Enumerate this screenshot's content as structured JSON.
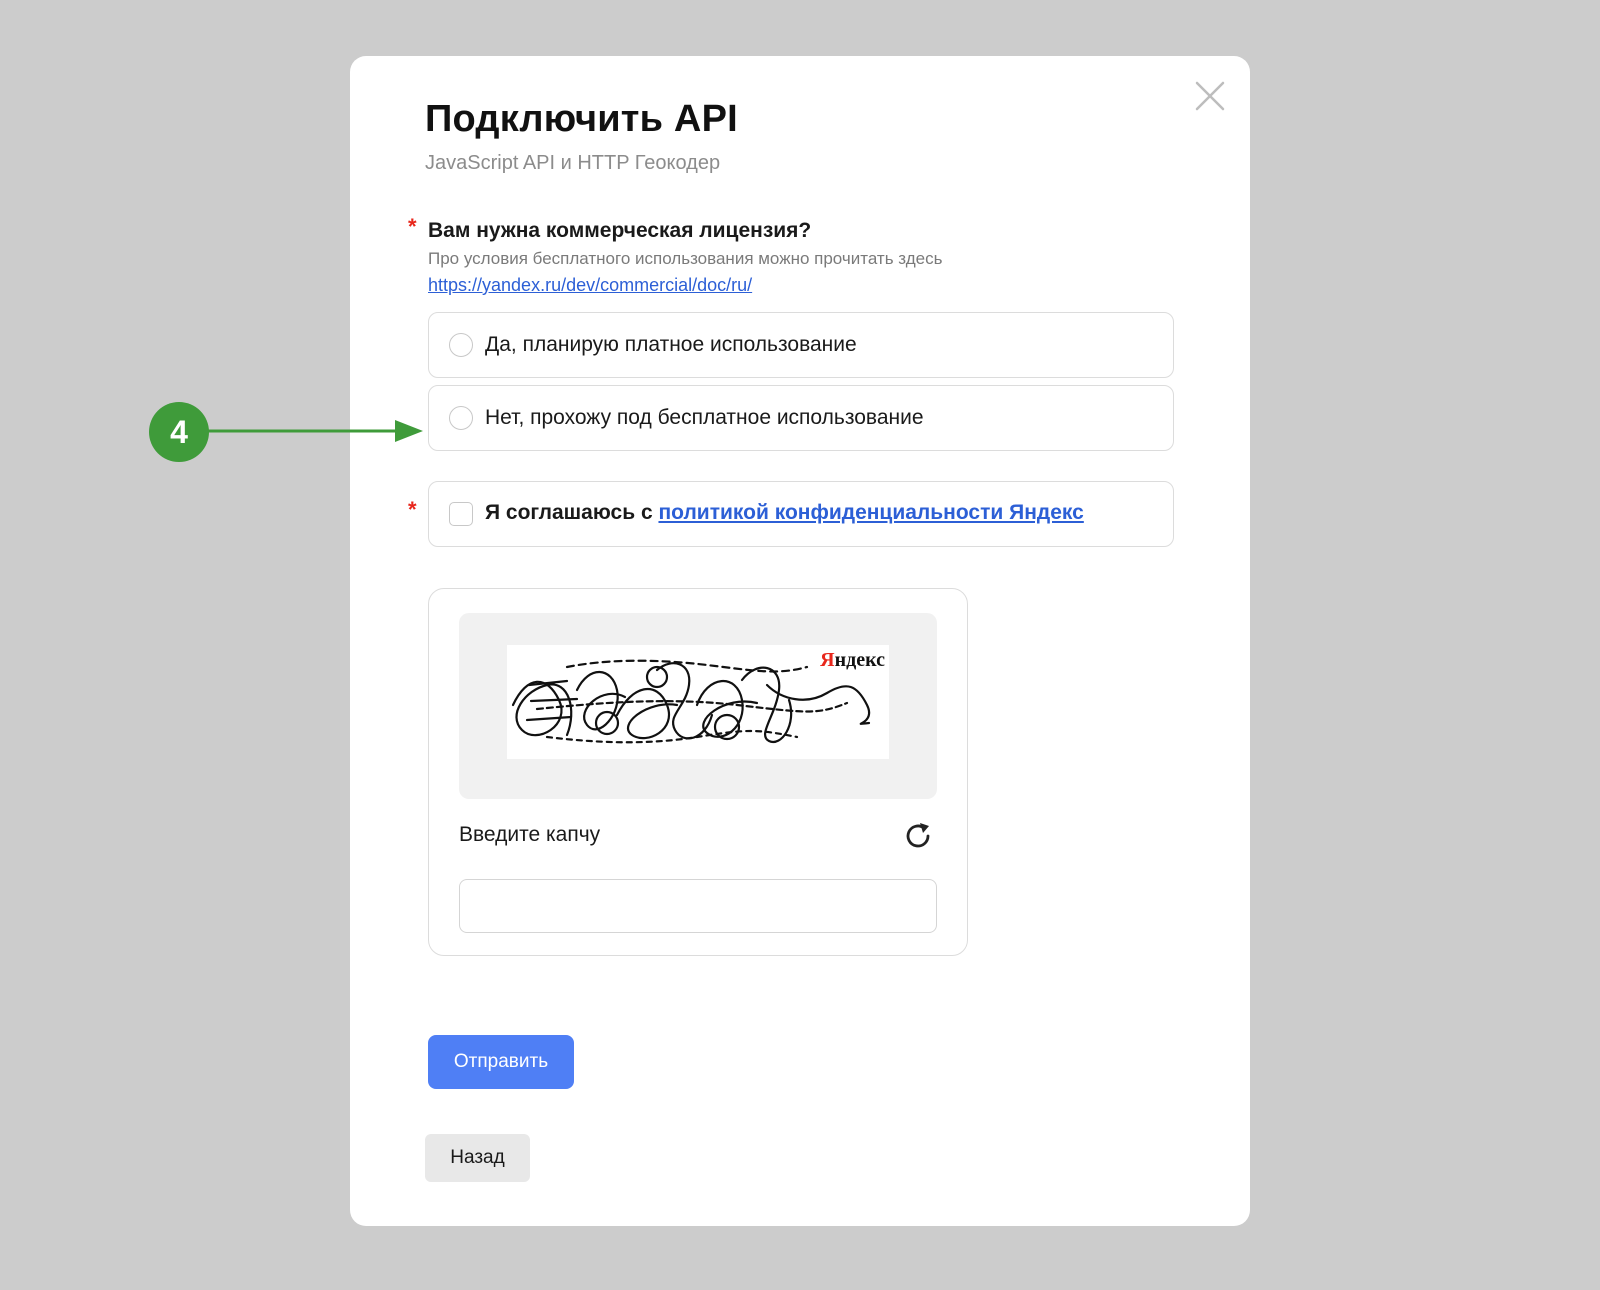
{
  "modal": {
    "title": "Подключить API",
    "subtitle": "JavaScript API и HTTP Геокодер",
    "close_icon": "close-icon"
  },
  "license_question": {
    "required_marker": "*",
    "label": "Вам нужна коммерческая лицензия?",
    "hint": "Про условия бесплатного использования можно прочитать здесь",
    "link": "https://yandex.ru/dev/commercial/doc/ru/",
    "options": [
      {
        "label": "Да, планирую платное использование",
        "selected": false
      },
      {
        "label": "Нет, прохожу под бесплатное использование",
        "selected": false
      }
    ]
  },
  "agreement": {
    "required_marker": "*",
    "prefix": "Я соглашаюсь с ",
    "link_text": "политикой конфиденциальности Яндекс",
    "checked": false
  },
  "captcha": {
    "logo_first": "Я",
    "logo_rest": "ндекс",
    "caption": "Введите капчу",
    "refresh_icon": "refresh-icon",
    "input_value": "",
    "input_placeholder": ""
  },
  "actions": {
    "submit_label": "Отправить",
    "back_label": "Назад"
  },
  "annotation": {
    "step_number": "4"
  },
  "colors": {
    "background": "#cccccc",
    "primary_button": "#4f7ff5",
    "link": "#2c5fd6",
    "required": "#e8271c",
    "annotation": "#3f9b3a"
  }
}
